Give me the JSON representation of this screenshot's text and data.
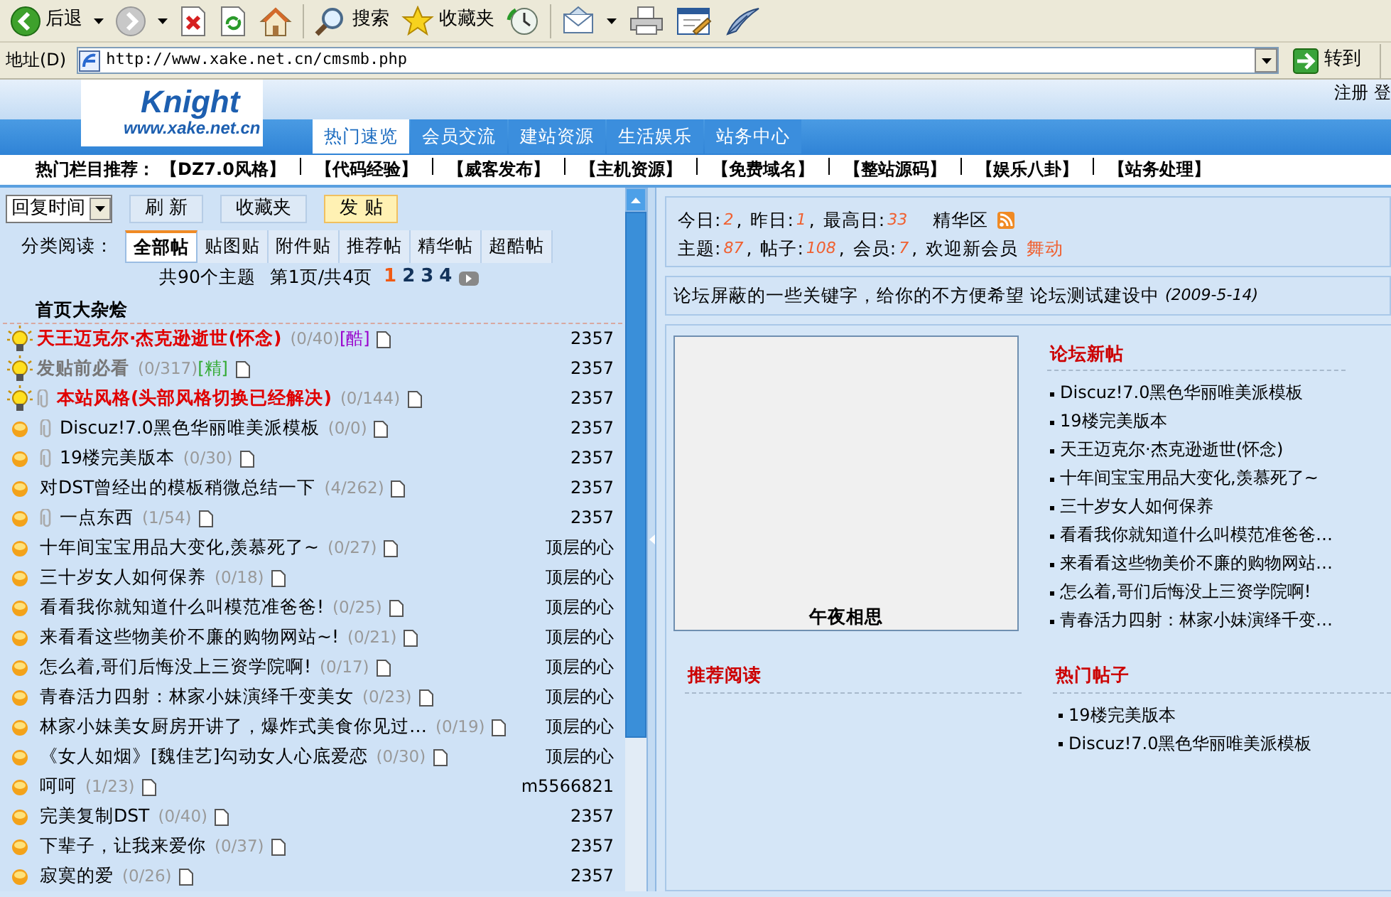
{
  "browser": {
    "toolbar": [
      {
        "kind": "back",
        "label": "后退",
        "dropdown": true
      },
      {
        "kind": "forward",
        "dropdown": true
      },
      {
        "kind": "stop"
      },
      {
        "kind": "refresh"
      },
      {
        "kind": "home"
      },
      {
        "kind": "search",
        "label": "搜索"
      },
      {
        "kind": "favorites",
        "label": "收藏夹"
      },
      {
        "kind": "history"
      },
      {
        "kind": "mail",
        "dropdown": true
      },
      {
        "kind": "print"
      },
      {
        "kind": "edit"
      },
      {
        "kind": "messenger"
      }
    ],
    "address_label": "地址(D)",
    "url": "http://www.xake.net.cn/cmsmb.php",
    "go": "转到"
  },
  "site": {
    "logo": {
      "name": "Knight",
      "domain": "www.xake.net.cn"
    },
    "user_links": [
      "注册",
      "登"
    ],
    "nav": [
      {
        "label": "热门速览",
        "selected": true
      },
      {
        "label": "会员交流",
        "selected": false
      },
      {
        "label": "建站资源",
        "selected": false
      },
      {
        "label": "生活娱乐",
        "selected": false
      },
      {
        "label": "站务中心",
        "selected": false
      }
    ],
    "hot_label": "热门栏目推荐：",
    "hot_links": [
      "【DZ7.0风格】",
      "【代码经验】",
      "【威客发布】",
      "【主机资源】",
      "【免费域名】",
      "【整站源码】",
      "【娱乐八卦】",
      "【站务处理】"
    ]
  },
  "thread_list": {
    "sort": "回复时间",
    "buttons": [
      {
        "label": "刷 新",
        "kind": "plain"
      },
      {
        "label": "收藏夹",
        "kind": "plain"
      },
      {
        "label": "发 贴",
        "kind": "post"
      }
    ],
    "filter_label": "分类阅读：",
    "filters": [
      {
        "label": "全部帖",
        "selected": true
      },
      {
        "label": "贴图贴",
        "selected": false
      },
      {
        "label": "附件贴",
        "selected": false
      },
      {
        "label": "推荐帖",
        "selected": false
      },
      {
        "label": "精华帖",
        "selected": false
      },
      {
        "label": "超酷帖",
        "selected": false
      }
    ],
    "summary": "共90个主题",
    "page_info": "第1页/共4页",
    "pages": [
      {
        "label": "1",
        "selected": true
      },
      {
        "label": "2",
        "selected": false
      },
      {
        "label": "3",
        "selected": false
      },
      {
        "label": "4",
        "selected": false
      }
    ],
    "section": "首页大杂烩",
    "threads": [
      {
        "kind": "pinned",
        "attachment": false,
        "title": "天王迈克尔·杰克逊逝世(怀念)",
        "bold": true,
        "color": "#e00000",
        "stats": "(0/40)",
        "tag": {
          "text": "[酷]",
          "color": "#9900cc"
        },
        "author": "2357"
      },
      {
        "kind": "pinned",
        "attachment": false,
        "title": "发贴前必看",
        "bold": true,
        "color": "#777777",
        "stats": "(0/317)",
        "tag": {
          "text": "[精]",
          "color": "#33aa33"
        },
        "author": "2357"
      },
      {
        "kind": "pinned",
        "attachment": true,
        "title": "本站风格(头部风格切换已经解决)",
        "bold": true,
        "color": "#e00000",
        "stats": "(0/144)",
        "author": "2357"
      },
      {
        "kind": "normal",
        "attachment": true,
        "title": "Discuz!7.0黑色华丽唯美派模板",
        "stats": "(0/0)",
        "author": "2357"
      },
      {
        "kind": "normal",
        "attachment": true,
        "title": "19楼完美版本",
        "stats": "(0/30)",
        "author": "2357"
      },
      {
        "kind": "normal",
        "attachment": false,
        "title": "对DST曾经出的模板稍微总结一下",
        "stats": "(4/262)",
        "author": "2357"
      },
      {
        "kind": "normal",
        "attachment": true,
        "title": "一点东西",
        "stats": "(1/54)",
        "author": "2357"
      },
      {
        "kind": "normal",
        "attachment": false,
        "title": "十年间宝宝用品大变化,羡慕死了~",
        "stats": "(0/27)",
        "author": "顶层的心"
      },
      {
        "kind": "normal",
        "attachment": false,
        "title": "三十岁女人如何保养",
        "stats": "(0/18)",
        "author": "顶层的心"
      },
      {
        "kind": "normal",
        "attachment": false,
        "title": "看看我你就知道什么叫模范准爸爸!",
        "stats": "(0/25)",
        "author": "顶层的心"
      },
      {
        "kind": "normal",
        "attachment": false,
        "title": "来看看这些物美价不廉的购物网站~!",
        "stats": "(0/21)",
        "author": "顶层的心"
      },
      {
        "kind": "normal",
        "attachment": false,
        "title": "怎么着,哥们后悔没上三资学院啊!",
        "stats": "(0/17)",
        "author": "顶层的心"
      },
      {
        "kind": "normal",
        "attachment": false,
        "title": "青春活力四射：林家小妹演绎千变美女",
        "stats": "(0/23)",
        "author": "顶层的心"
      },
      {
        "kind": "normal",
        "attachment": false,
        "title": "林家小妹美女厨房开讲了，爆炸式美食你见过…",
        "stats": "(0/19)",
        "author": "顶层的心"
      },
      {
        "kind": "normal",
        "attachment": false,
        "title": "《女人如烟》[魏佳艺]勾动女人心底爱恋",
        "stats": "(0/30)",
        "author": "顶层的心"
      },
      {
        "kind": "normal",
        "attachment": false,
        "title": "呵呵",
        "stats": "(1/23)",
        "author": "m5566821"
      },
      {
        "kind": "normal",
        "attachment": false,
        "title": "完美复制DST",
        "stats": "(0/40)",
        "author": "2357"
      },
      {
        "kind": "normal",
        "attachment": false,
        "title": "下辈子，让我来爱你",
        "stats": "(0/37)",
        "author": "2357"
      },
      {
        "kind": "normal",
        "attachment": false,
        "title": "寂寞的爱",
        "stats": "(0/26)",
        "author": "2357"
      }
    ]
  },
  "stats": {
    "row1": [
      {
        "label": "今日:",
        "value": "2",
        "suffix": ","
      },
      {
        "label": "昨日:",
        "value": "1",
        "suffix": ","
      },
      {
        "label": "最高日:",
        "value": "33"
      }
    ],
    "digest": "精华区",
    "row2": [
      {
        "label": "主题:",
        "value": "87",
        "suffix": ","
      },
      {
        "label": "帖子:",
        "value": "108",
        "suffix": ","
      },
      {
        "label": "会员:",
        "value": "7",
        "suffix": ","
      }
    ],
    "welcome": "欢迎新会员",
    "new_member": "舞动"
  },
  "notice": {
    "text": "论坛屏蔽的一些关键字，给你的不方便希望 论坛测试建设中",
    "date": "(2009-5-14)"
  },
  "feature": {
    "caption": "午夜相思"
  },
  "new_posts": {
    "title": "论坛新帖",
    "items": [
      "Discuz!7.0黑色华丽唯美派模板",
      "19楼完美版本",
      "天王迈克尔·杰克逊逝世(怀念)",
      "十年间宝宝用品大变化,羡慕死了~",
      "三十岁女人如何保养",
      "看看我你就知道什么叫模范准爸爸…",
      "来看看这些物美价不廉的购物网站…",
      "怎么着,哥们后悔没上三资学院啊!",
      "青春活力四射：林家小妹演绎千变…"
    ]
  },
  "recommended": {
    "title": "推荐阅读"
  },
  "hot_posts": {
    "title": "热门帖子",
    "items": [
      "19楼完美版本",
      "Discuz!7.0黑色华丽唯美派模板"
    ]
  }
}
